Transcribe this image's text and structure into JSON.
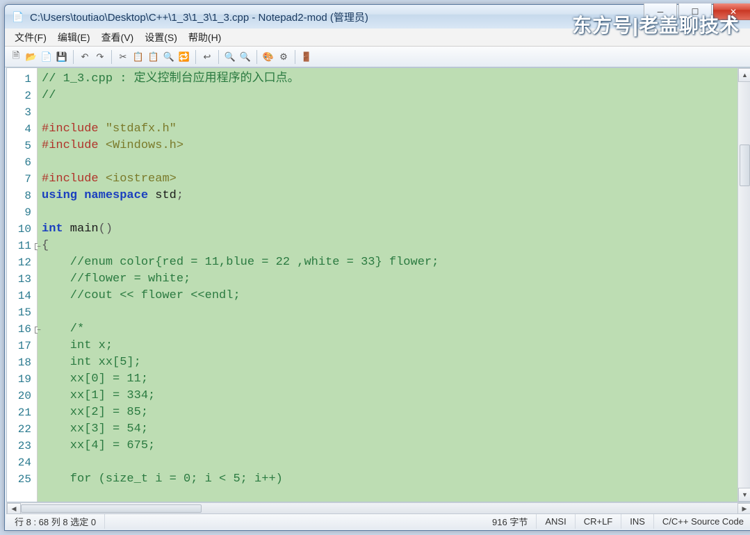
{
  "title": "C:\\Users\\toutiao\\Desktop\\C++\\1_3\\1_3\\1_3.cpp - Notepad2-mod (管理员)",
  "watermark": "东方号|老盖聊技术",
  "menu": [
    "文件(F)",
    "编辑(E)",
    "查看(V)",
    "设置(S)",
    "帮助(H)"
  ],
  "toolbar_icons": [
    {
      "name": "new-icon",
      "glyph": "🗎"
    },
    {
      "name": "open-icon",
      "glyph": "📂"
    },
    {
      "name": "recent-icon",
      "glyph": "📄"
    },
    {
      "name": "save-icon",
      "glyph": "💾"
    },
    {
      "name": "sep"
    },
    {
      "name": "undo-icon",
      "glyph": "↶"
    },
    {
      "name": "redo-icon",
      "glyph": "↷"
    },
    {
      "name": "sep"
    },
    {
      "name": "cut-icon",
      "glyph": "✂"
    },
    {
      "name": "copy-icon",
      "glyph": "📋"
    },
    {
      "name": "paste-icon",
      "glyph": "📋"
    },
    {
      "name": "find-icon",
      "glyph": "🔍"
    },
    {
      "name": "replace-icon",
      "glyph": "🔁"
    },
    {
      "name": "sep"
    },
    {
      "name": "wordwrap-icon",
      "glyph": "↩"
    },
    {
      "name": "sep"
    },
    {
      "name": "zoomin-icon",
      "glyph": "🔍+"
    },
    {
      "name": "zoomout-icon",
      "glyph": "🔍-"
    },
    {
      "name": "sep"
    },
    {
      "name": "scheme-icon",
      "glyph": "🎨"
    },
    {
      "name": "config-icon",
      "glyph": "⚙"
    },
    {
      "name": "sep"
    },
    {
      "name": "exit-icon",
      "glyph": "🚪"
    }
  ],
  "code_lines": [
    {
      "n": 1,
      "text": "// 1_3.cpp : 定义控制台应用程序的入口点。",
      "cls": "c-comment"
    },
    {
      "n": 2,
      "text": "//",
      "cls": "c-comment"
    },
    {
      "n": 3,
      "text": "",
      "cls": ""
    },
    {
      "n": 4,
      "html": "<span class='c-pp'>#include</span> <span class='c-str'>\"stdafx.h\"</span>"
    },
    {
      "n": 5,
      "html": "<span class='c-pp'>#include</span> <span class='c-str'>&lt;Windows.h&gt;</span>"
    },
    {
      "n": 6,
      "text": "",
      "cls": ""
    },
    {
      "n": 7,
      "html": "<span class='c-pp'>#include</span> <span class='c-str'>&lt;iostream&gt;</span>"
    },
    {
      "n": 8,
      "html": "<span class='c-kw'>using</span> <span class='c-kw'>namespace</span> std<span class='c-pun'>;</span>"
    },
    {
      "n": 9,
      "text": "",
      "cls": ""
    },
    {
      "n": 10,
      "html": "<span class='c-kw'>int</span> main<span class='c-pun'>()</span>"
    },
    {
      "n": 11,
      "text": "{",
      "cls": "c-pun",
      "fold": true
    },
    {
      "n": 12,
      "text": "    //enum color{red = 11,blue = 22 ,white = 33} flower;",
      "cls": "c-comment"
    },
    {
      "n": 13,
      "text": "    //flower = white;",
      "cls": "c-comment"
    },
    {
      "n": 14,
      "text": "    //cout << flower <<endl;",
      "cls": "c-comment"
    },
    {
      "n": 15,
      "text": "",
      "cls": ""
    },
    {
      "n": 16,
      "text": "    /*",
      "cls": "c-comment",
      "fold": true
    },
    {
      "n": 17,
      "text": "    int x;",
      "cls": "c-comment"
    },
    {
      "n": 18,
      "text": "    int xx[5];",
      "cls": "c-comment"
    },
    {
      "n": 19,
      "text": "    xx[0] = 11;",
      "cls": "c-comment"
    },
    {
      "n": 20,
      "text": "    xx[1] = 334;",
      "cls": "c-comment"
    },
    {
      "n": 21,
      "text": "    xx[2] = 85;",
      "cls": "c-comment"
    },
    {
      "n": 22,
      "text": "    xx[3] = 54;",
      "cls": "c-comment"
    },
    {
      "n": 23,
      "text": "    xx[4] = 675;",
      "cls": "c-comment"
    },
    {
      "n": 24,
      "text": "",
      "cls": "c-comment"
    },
    {
      "n": 25,
      "text": "    for (size_t i = 0; i < 5; i++)",
      "cls": "c-comment"
    }
  ],
  "status": {
    "pos": "行 8 : 68  列 8  选定 0",
    "bytes": "916 字节",
    "encoding": "ANSI",
    "eol": "CR+LF",
    "mode": "INS",
    "lang": "C/C++ Source Code"
  }
}
